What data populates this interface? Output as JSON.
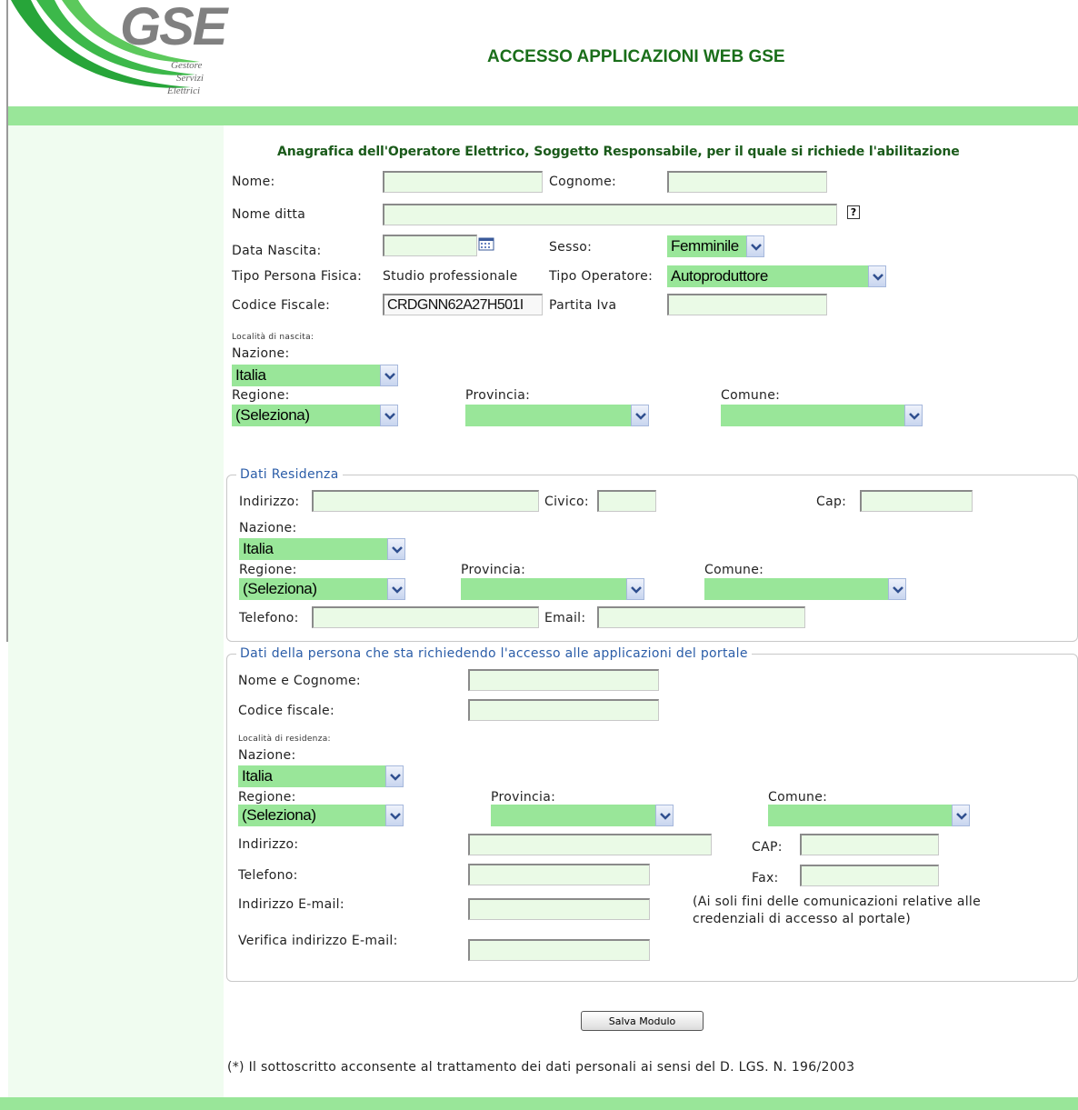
{
  "header": {
    "logo_text": "GSE",
    "logo_sub": [
      "Gestore",
      "Servizi",
      "Elettrici"
    ],
    "title": "ACCESSO APPLICAZIONI WEB GSE",
    "brand_green": "#99e699",
    "title_color": "#1a6e1a"
  },
  "section_title": "Anagrafica dell'Operatore Elettrico, Soggetto Responsabile, per il quale si richiede l'abilitazione",
  "operator": {
    "nome_label": "Nome:",
    "cognome_label": "Cognome:",
    "nome_ditta_label": "Nome ditta",
    "data_nascita_label": "Data Nascita:",
    "sesso_label": "Sesso:",
    "sesso_value": "Femminile",
    "tipo_persona_label": "Tipo Persona Fisica:",
    "tipo_persona_value": "Studio professionale",
    "tipo_operatore_label": "Tipo Operatore:",
    "tipo_operatore_value": "Autoproduttore",
    "codice_fiscale_label": "Codice Fiscale:",
    "codice_fiscale_value": "CRDGNN62A27H501I",
    "partita_iva_label": "Partita Iva",
    "localita_label": "Località di nascita:",
    "nazione_label": "Nazione:",
    "nazione_value": "Italia",
    "regione_label": "Regione:",
    "regione_value": "(Seleziona)",
    "provincia_label": "Provincia:",
    "comune_label": "Comune:"
  },
  "residenza": {
    "legend": "Dati Residenza",
    "indirizzo_label": "Indirizzo:",
    "civico_label": "Civico:",
    "cap_label": "Cap:",
    "nazione_label": "Nazione:",
    "nazione_value": "Italia",
    "regione_label": "Regione:",
    "regione_value": "(Seleziona)",
    "provincia_label": "Provincia:",
    "comune_label": "Comune:",
    "telefono_label": "Telefono:",
    "email_label": "Email:"
  },
  "richiedente": {
    "legend": "Dati della persona che sta richiedendo l'accesso alle applicazioni del portale",
    "nome_cognome_label": "Nome e Cognome:",
    "codice_fiscale_label": "Codice fiscale:",
    "localita_label": "Località di residenza:",
    "nazione_label": "Nazione:",
    "nazione_value": "Italia",
    "regione_label": "Regione:",
    "regione_value": "(Seleziona)",
    "provincia_label": "Provincia:",
    "comune_label": "Comune:",
    "indirizzo_label": "Indirizzo:",
    "cap_label": "CAP:",
    "telefono_label": "Telefono:",
    "fax_label": "Fax:",
    "email_label": "Indirizzo E-mail:",
    "email_note_1": "(Ai soli fini delle comunicazioni relative alle",
    "email_note_2": "credenziali di accesso al portale)",
    "verifica_email_label": "Verifica indirizzo E-mail:"
  },
  "save_button": "Salva Modulo",
  "consent_text": "(*) Il sottoscritto acconsente al trattamento dei dati personali ai sensi del D. LGS. N. 196/2003"
}
